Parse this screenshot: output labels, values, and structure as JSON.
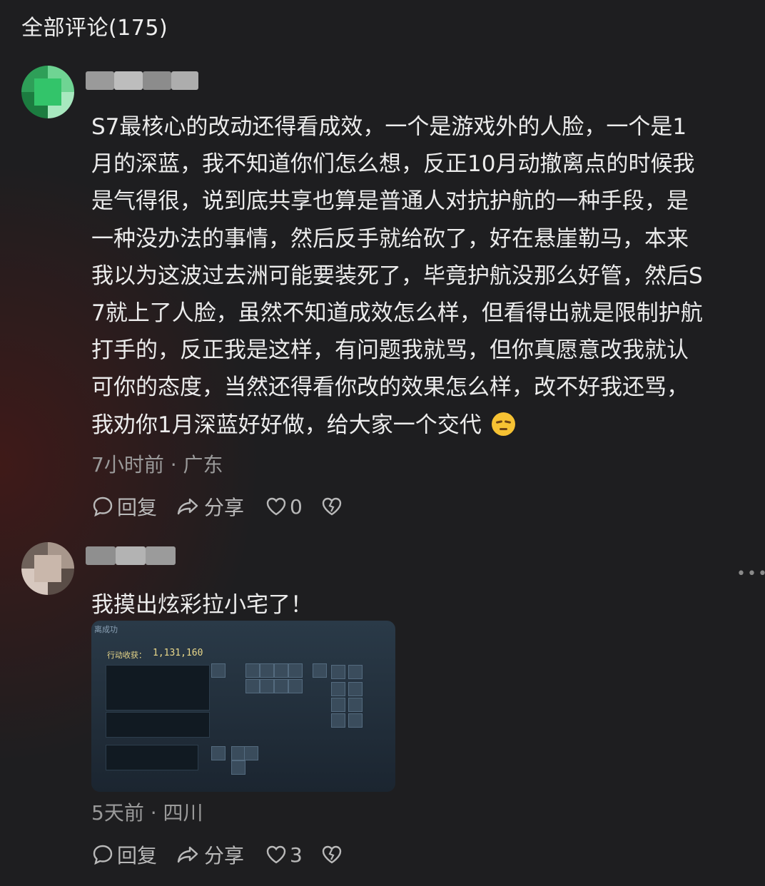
{
  "header": {
    "title": "全部评论(175)"
  },
  "comments": [
    {
      "text_lines": [
        "S7最核心的改动还得看成效，一个是游戏外的人脸，一个是1",
        "月的深蓝，我不知道你们怎么想，反正10月动撤离点的时候我",
        "是气得很，说到底共享也算是普通人对抗护航的一种手段，是",
        "一种没办法的事情，然后反手就给砍了，好在悬崖勒马，本来",
        "我以为这波过去洲可能要装死了，毕竟护航没那么好管，然后S",
        "7就上了人脸，虽然不知道成效怎么样，但看得出就是限制护航",
        "打手的，反正我是这样，有问题我就骂，但你真愿意改我就认",
        "可你的态度，当然还得看你改的效果怎么样，改不好我还骂，",
        "我劝你1月深蓝好好做，给大家一个交代"
      ],
      "emoji": "unamused-face-emoji",
      "meta": "7小时前 · 广东",
      "reply_label": "回复",
      "share_label": "分享",
      "like_count": "0",
      "avatar_colors": [
        "#33c46a",
        "#7ee0a0",
        "#1f8f4b",
        "#b9f0cc"
      ]
    },
    {
      "text": "我摸出炫彩拉小宅了！",
      "meta": "5天前 · 四川",
      "reply_label": "回复",
      "share_label": "分享",
      "like_count": "3",
      "avatar_colors": [
        "#8a7a70",
        "#c9b7ab",
        "#5e504a",
        "#e0d4cc"
      ],
      "screenshot": {
        "caption_top": "离成功",
        "value_label": "行动收获：",
        "value": "1,131,160"
      }
    }
  ],
  "colors": {
    "background": "#1e1e20",
    "text": "#ececec",
    "meta": "#9a9a9a"
  },
  "icons": {
    "reply": "speech-bubble-icon",
    "share": "share-arrow-icon",
    "like": "heart-icon",
    "dislike": "broken-heart-icon",
    "more": "more-dots-icon"
  }
}
